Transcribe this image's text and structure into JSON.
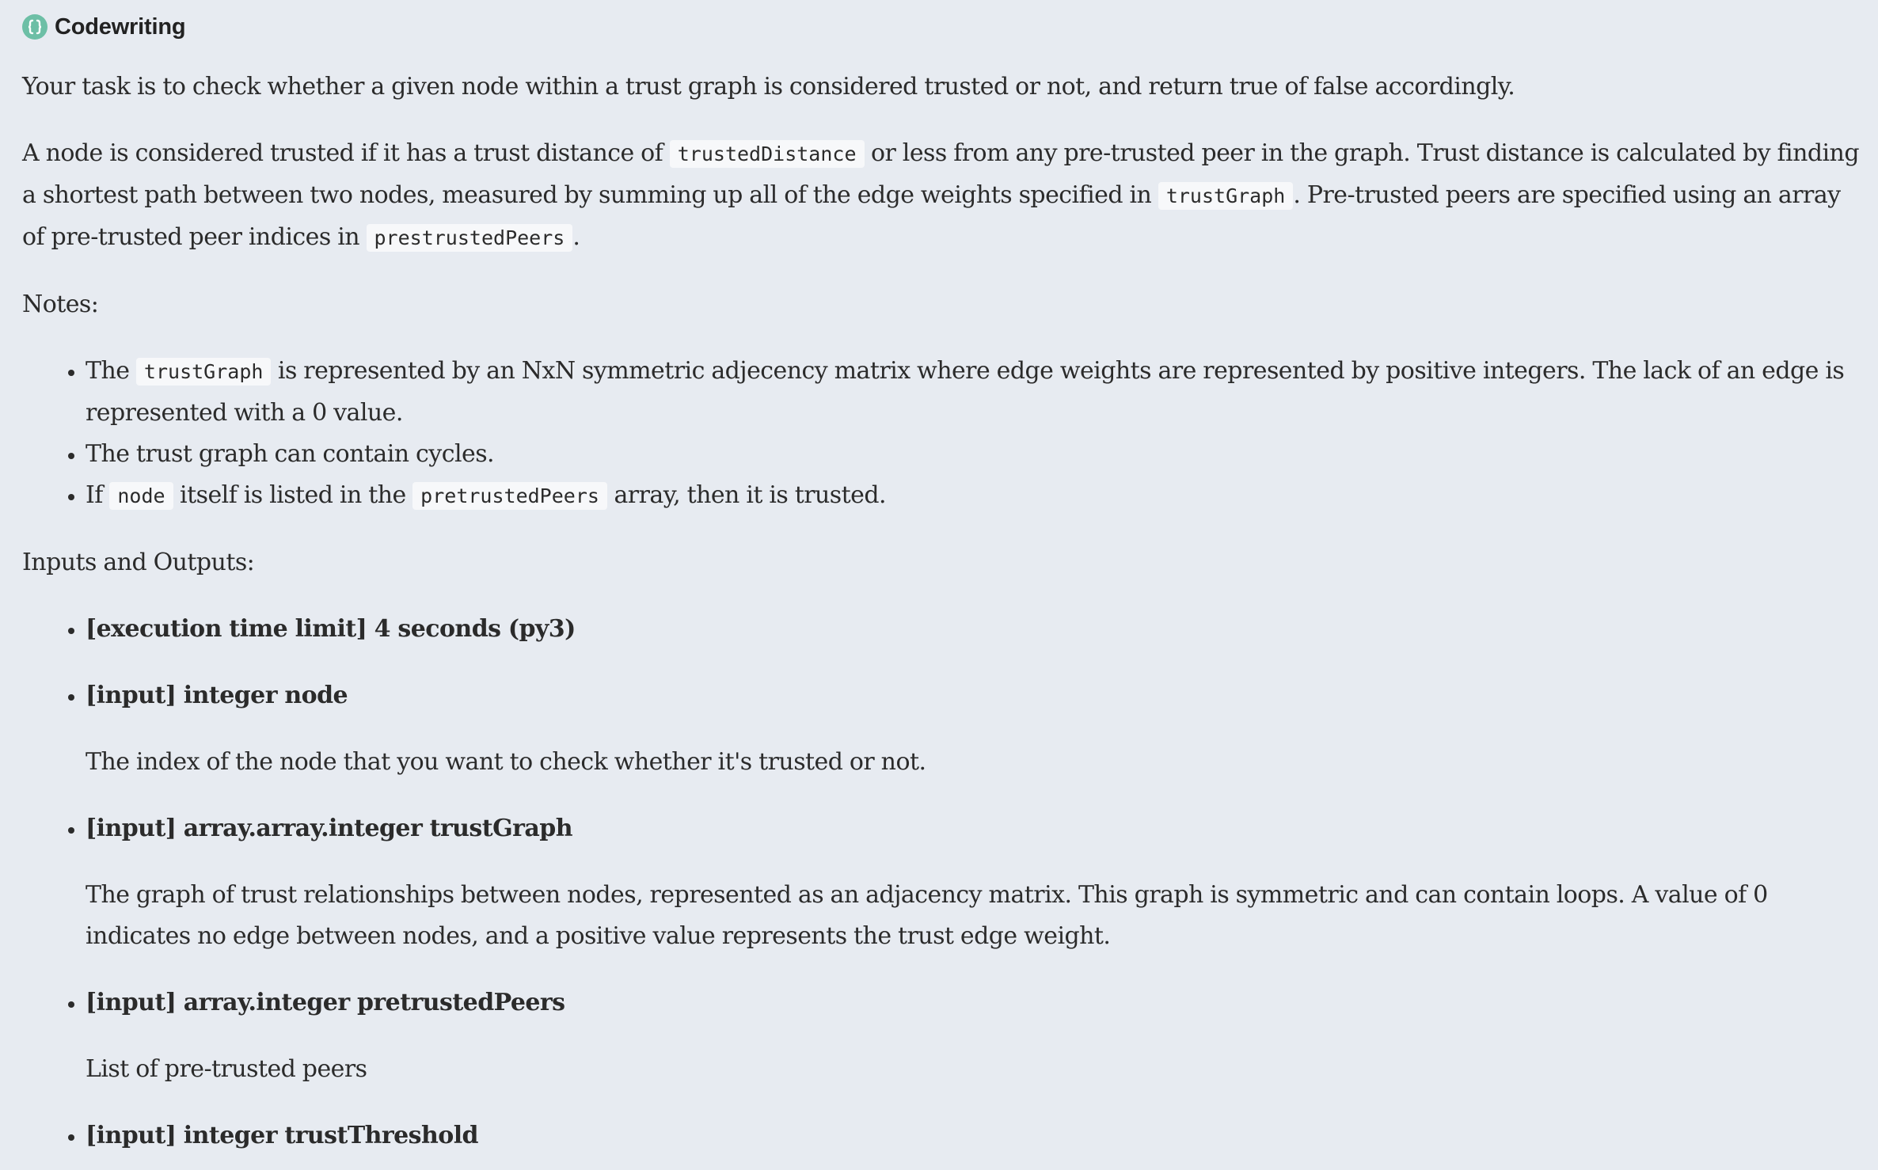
{
  "header": {
    "brand": "Codewriting",
    "logo_icon": "curly-braces-icon",
    "accent_color": "#6dbfa6"
  },
  "intro": {
    "p1": "Your task is to check whether a given node within a trust graph is considered trusted or not, and return true of false accordingly.",
    "p2": {
      "t1": "A node is considered trusted if it has a trust distance of ",
      "c1": "trustedDistance",
      "t2": " or less from any pre-trusted peer in the graph. Trust distance is calculated by finding a shortest path between two nodes, measured by summing up all of the edge weights specified in ",
      "c2": "trustGraph",
      "t3": ". Pre-trusted peers are specified using an array of pre-trusted peer indices in ",
      "c3": "prestrustedPeers",
      "t4": "."
    }
  },
  "notes": {
    "heading": "Notes:",
    "items": [
      {
        "t1": "The ",
        "c1": "trustGraph",
        "t2": " is represented by an NxN symmetric adjecency matrix where edge weights are represented by positive integers. The lack of an edge is represented with a 0 value."
      },
      {
        "t1": "The trust graph can contain cycles."
      },
      {
        "t1": "If ",
        "c1": "node",
        "t2": " itself is listed in the ",
        "c2": "pretrustedPeers",
        "t3": " array, then it is trusted."
      }
    ]
  },
  "io": {
    "heading": "Inputs and Outputs:",
    "items": [
      {
        "title": "[execution time limit] 4 seconds (py3)",
        "desc": ""
      },
      {
        "title": "[input] integer node",
        "desc": "The index of the node that you want to check whether it's trusted or not."
      },
      {
        "title": "[input] array.array.integer trustGraph",
        "desc": "The graph of trust relationships between nodes, represented as an adjacency matrix. This graph is symmetric and can contain loops. A value of 0 indicates no edge between nodes, and a positive value represents the trust edge weight."
      },
      {
        "title": "[input] array.integer pretrustedPeers",
        "desc": "List of pre-trusted peers"
      },
      {
        "title": "[input] integer trustThreshold",
        "desc": ""
      }
    ]
  }
}
